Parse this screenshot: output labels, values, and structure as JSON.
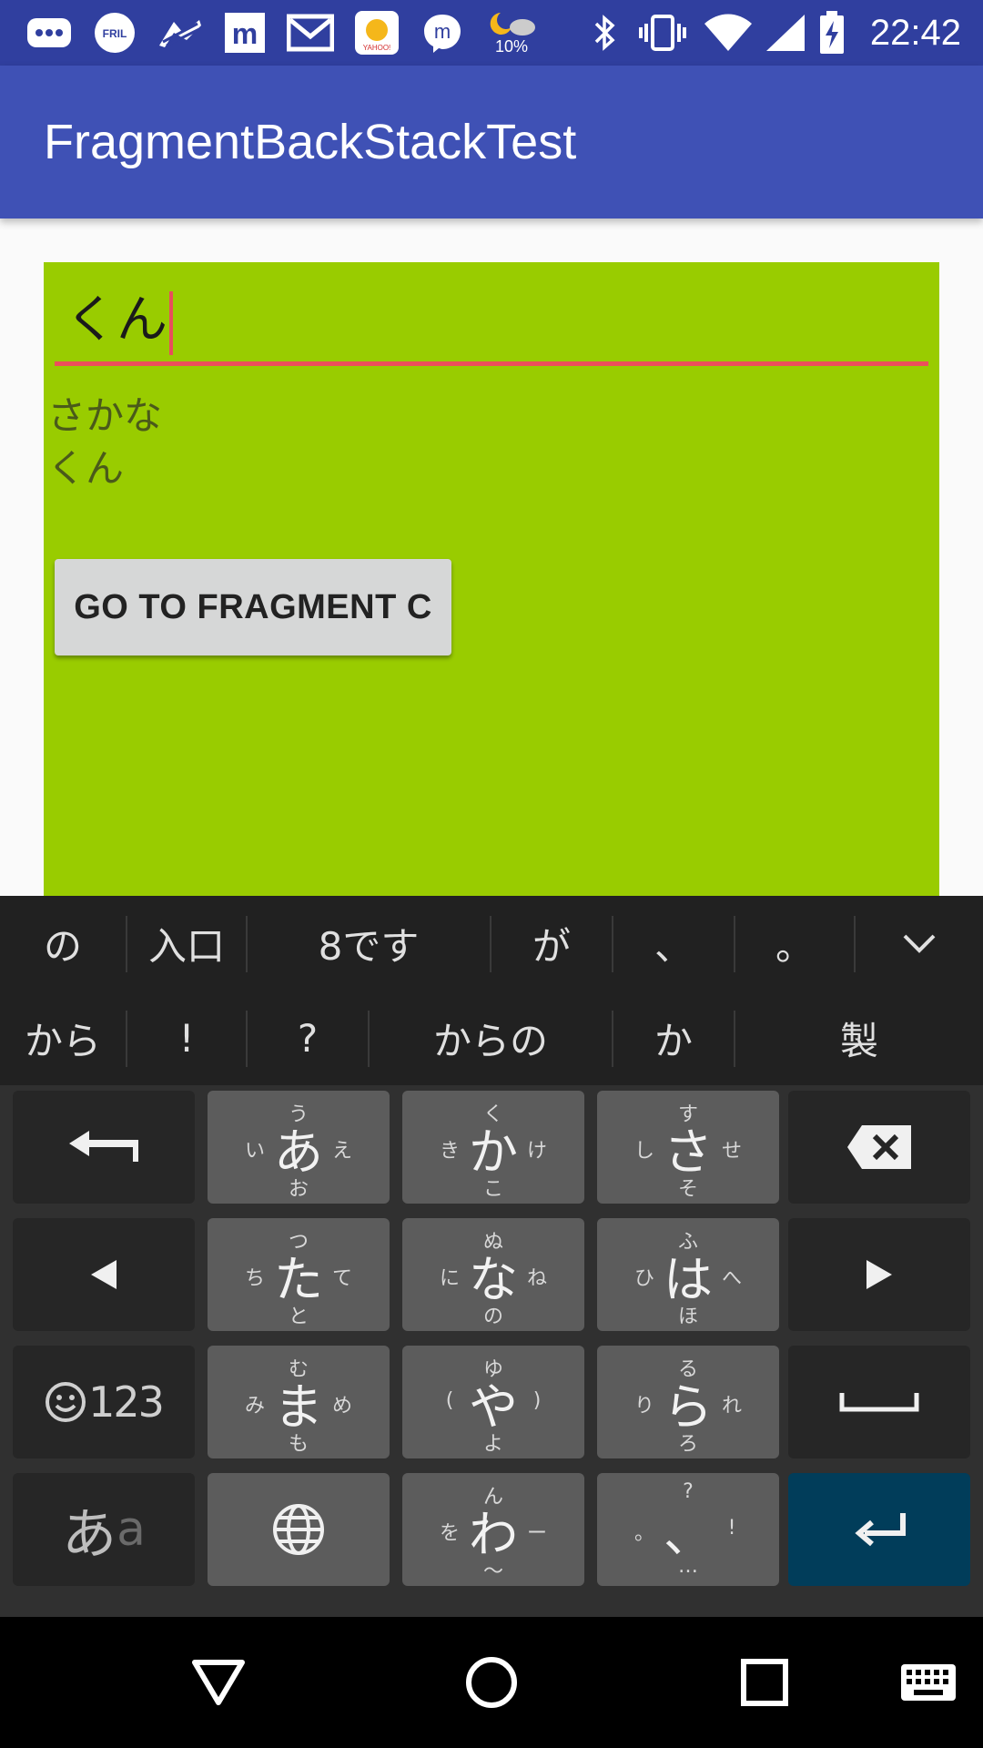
{
  "status_bar": {
    "time": "22:42",
    "weather_percent": "10%",
    "notification_icons": [
      "message-icon",
      "fril-icon",
      "zebra-icon",
      "m-app-icon",
      "gmail-icon",
      "yahoo-weather-icon",
      "messenger-icon",
      "weather-night-icon"
    ],
    "system_icons": [
      "bluetooth-icon",
      "vibrate-icon",
      "wifi-icon",
      "signal-icon",
      "battery-charging-icon"
    ]
  },
  "app_bar": {
    "title": "FragmentBackStackTest"
  },
  "fragment": {
    "background": "#99cc00",
    "input_value": "くん",
    "text_lines": [
      "さかな",
      "くん"
    ],
    "button_label": "GO TO FRAGMENT C"
  },
  "keyboard": {
    "candidates_row1": [
      "の",
      "入口",
      "8です",
      "が",
      "、",
      "。"
    ],
    "candidates_row2": [
      "から",
      "!",
      "?",
      "からの",
      "か",
      "製"
    ],
    "keys": {
      "a": {
        "main": "あ",
        "up": "う",
        "left": "い",
        "right": "え",
        "down": "お"
      },
      "ka": {
        "main": "か",
        "up": "く",
        "left": "き",
        "right": "け",
        "down": "こ"
      },
      "sa": {
        "main": "さ",
        "up": "す",
        "left": "し",
        "right": "せ",
        "down": "そ"
      },
      "ta": {
        "main": "た",
        "up": "つ",
        "left": "ち",
        "right": "て",
        "down": "と"
      },
      "na": {
        "main": "な",
        "up": "ぬ",
        "left": "に",
        "right": "ね",
        "down": "の"
      },
      "ha": {
        "main": "は",
        "up": "ふ",
        "left": "ひ",
        "right": "へ",
        "down": "ほ"
      },
      "ma": {
        "main": "ま",
        "up": "む",
        "left": "み",
        "right": "め",
        "down": "も"
      },
      "ya": {
        "main": "や",
        "up": "ゆ",
        "left": "(",
        "right": ")",
        "down": "よ"
      },
      "ra": {
        "main": "ら",
        "up": "る",
        "left": "り",
        "right": "れ",
        "down": "ろ"
      },
      "wa": {
        "main": "わ",
        "up": "ん",
        "left": "を",
        "right": "ー",
        "down": "〜"
      },
      "punct": {
        "main": "、",
        "up": "?",
        "left": "。",
        "right": "!",
        "down": "…"
      },
      "mode_123": "123",
      "kana_main": "あ",
      "kana_sub": "a"
    },
    "accent_enter": "#013d5a"
  },
  "nav_bar": {
    "buttons": [
      "back-icon",
      "home-icon",
      "recents-icon",
      "keyboard-switch-icon"
    ]
  }
}
